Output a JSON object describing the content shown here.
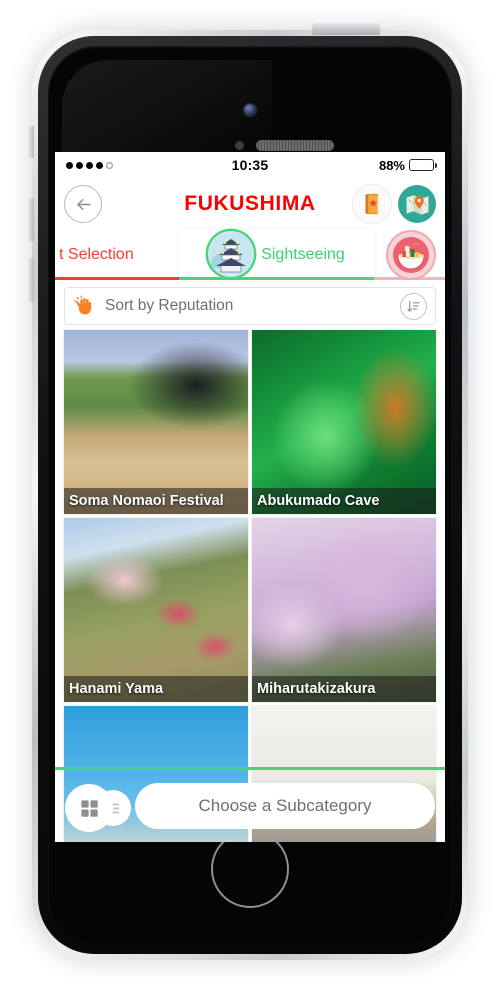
{
  "status_bar": {
    "signal_dots_filled": 4,
    "signal_dots_total": 5,
    "time": "10:35",
    "battery_percent": "88%",
    "battery_level": 88
  },
  "nav": {
    "back_icon": "arrow-left-icon",
    "title": "FUKUSHIMA",
    "guidebook_icon": "guidebook-icon",
    "map_icon": "map-pin-icon"
  },
  "tabs": [
    {
      "label": "t Selection",
      "icon": "star-icon",
      "active": false,
      "color": "#fe3b30"
    },
    {
      "label": "Sightseeing",
      "icon": "castle-icon",
      "active": true,
      "color": "#3ecf72"
    },
    {
      "label": "",
      "icon": "ramen-icon",
      "active": false,
      "color": "#f0b7bb"
    }
  ],
  "sort": {
    "icon": "clap-hand-icon",
    "label": "Sort by Reputation",
    "button_icon": "sort-descending-icon"
  },
  "grid": {
    "tiles": [
      {
        "caption": "Soma Nomaoi Festival",
        "art": "art-nomaoi"
      },
      {
        "caption": "Abukumado Cave",
        "art": "art-cave"
      },
      {
        "caption": "Hanami Yama",
        "art": "art-hanami"
      },
      {
        "caption": "Miharutakizakura",
        "art": "art-sakura"
      },
      {
        "caption": "",
        "art": "art-sign"
      },
      {
        "caption": "",
        "art": "art-roof"
      }
    ]
  },
  "bottom": {
    "view_toggle_icon": "grid-view-icon",
    "list_view_icon": "list-view-icon",
    "subcategory_label": "Choose a Subcategory"
  },
  "colors": {
    "brand_red": "#fe0000",
    "accent_green": "#4bd37b",
    "tab_red": "#fe3b30",
    "orange": "#f5832a",
    "map_teal": "#2fa89a"
  },
  "device": {
    "home_button": "home-button",
    "power_button": "power-button",
    "volume_up": "volume-up-button",
    "volume_down": "volume-down-button",
    "silent_switch": "silent-switch",
    "camera": "front-camera",
    "speaker": "earpiece-speaker"
  }
}
